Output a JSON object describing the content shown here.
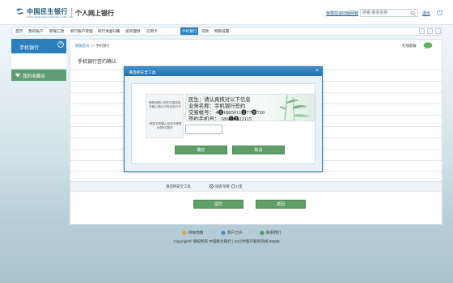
{
  "header": {
    "bank_name": "中国民生银行",
    "bank_name_en": "CHINA MINSHENG BANKING CORP.,LTD.",
    "site_title": "个人网上银行",
    "top_link": "我要隐退旧版网银",
    "search_placeholder": "搜索 菜单名称",
    "logout": "退出"
  },
  "nav": {
    "items": [
      "首页",
      "我的账户",
      "转账汇款",
      "跨行账户管理",
      "跨行资金归集",
      "投资理财",
      "信用卡",
      "手机银行",
      "贷款",
      "网银设置"
    ],
    "active_index": 7
  },
  "sidebar": {
    "header": "手机银行",
    "favorites": "我的收藏夹"
  },
  "main": {
    "breadcrumb_home": "网银首页",
    "breadcrumb_sep": ">>",
    "breadcrumb_current": "手机银行",
    "user_greet": "在线客服",
    "page_heading": "手机银行签约确认",
    "control_label": "请选择安全工具",
    "control_option1": "动态令牌",
    "control_option2": "U宝",
    "submit": "提交",
    "back": "返回"
  },
  "dialog": {
    "title": "请选择安全工具",
    "close": "×",
    "label_top": "请核对图片中的交易信息,并输入图片中的动态口令",
    "label_bottom": "请在右侧输入动态令牌显示的6位数字",
    "captcha_lines": [
      "民生：请认真核对以下信息",
      "业务名称：手机银行签约",
      "交易帐号：  4❻1865011❷77❾720",
      "签约手机号：  186❶❸22115"
    ],
    "input_value": "",
    "confirm": "确定",
    "cancel": "取消"
  },
  "footer": {
    "links": [
      "网站地图",
      "客户之声",
      "联系我们"
    ],
    "copyright": "Copyright© 版权所有 中国民生银行 | 24小时客户服务热线 95568"
  },
  "colors": {
    "brand_blue": "#2b7fbd",
    "green_button": "#5f9e66",
    "favorites_green": "#5f9e73"
  }
}
